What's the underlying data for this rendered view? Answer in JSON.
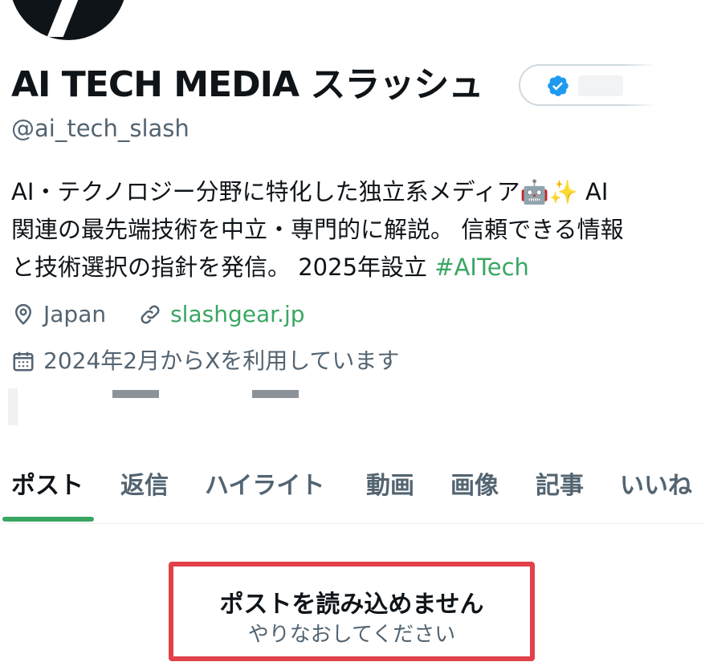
{
  "profile": {
    "display_name": "AI TECH MEDIA スラッシュ",
    "handle": "@ai_tech_slash",
    "bio_lines": [
      "AI・テクノロジー分野に特化した独立系メディア",
      "関連の最先端技術を中立・専門的に解説。 信頼できる情報",
      "と技術選択の指針を発信。 2025年設立 "
    ],
    "bio_emoji": "🤖✨",
    "bio_after_emoji": " AI",
    "bio_hashtag": "#AITech",
    "location": "Japan",
    "website": "slashgear.jp",
    "joined": "2024年2月からXを利用しています",
    "verified_icon": "verified-badge-icon",
    "accent_color": "#3aa663",
    "verified_color": "#1d9bf0"
  },
  "tabs": [
    {
      "label": "ポスト",
      "active": true
    },
    {
      "label": "返信",
      "active": false
    },
    {
      "label": "ハイライト",
      "active": false
    },
    {
      "label": "動画",
      "active": false
    },
    {
      "label": "画像",
      "active": false
    },
    {
      "label": "記事",
      "active": false
    },
    {
      "label": "いいね",
      "active": false
    }
  ],
  "error": {
    "title": "ポストを読み込めません",
    "subtitle": "やりなおしてください",
    "border_color": "#e24149"
  }
}
